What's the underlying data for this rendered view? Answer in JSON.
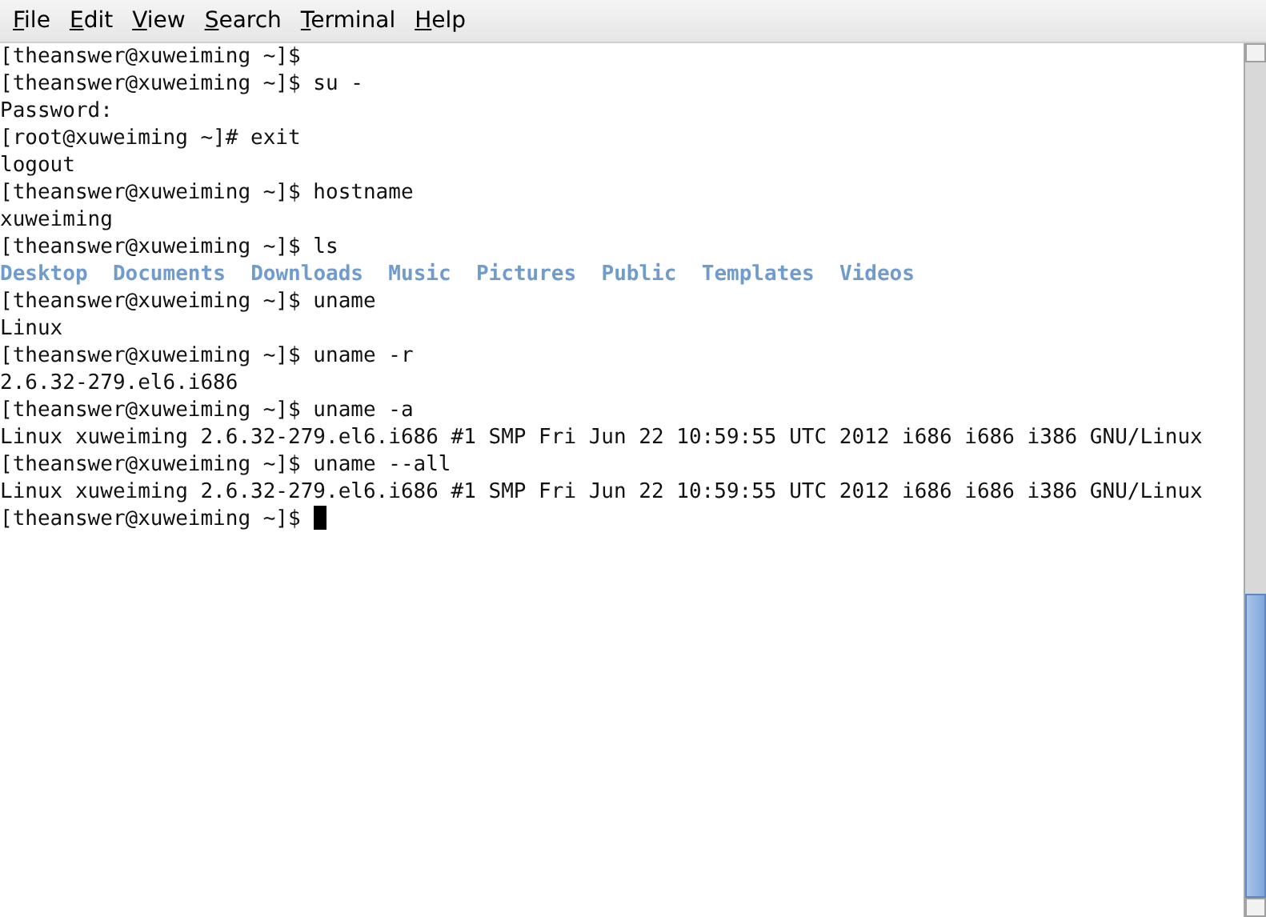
{
  "menu": [
    {
      "label": "File"
    },
    {
      "label": "Edit"
    },
    {
      "label": "View"
    },
    {
      "label": "Search"
    },
    {
      "label": "Terminal"
    },
    {
      "label": "Help"
    }
  ],
  "terminal": {
    "lines": [
      {
        "kind": "text",
        "text": "[theanswer@xuweiming ~]$"
      },
      {
        "kind": "text",
        "text": "[theanswer@xuweiming ~]$ su -"
      },
      {
        "kind": "text",
        "text": "Password:"
      },
      {
        "kind": "text",
        "text": "[root@xuweiming ~]# exit"
      },
      {
        "kind": "text",
        "text": "logout"
      },
      {
        "kind": "text",
        "text": "[theanswer@xuweiming ~]$ hostname"
      },
      {
        "kind": "text",
        "text": "xuweiming"
      },
      {
        "kind": "text",
        "text": "[theanswer@xuweiming ~]$ ls"
      },
      {
        "kind": "dirs",
        "entries": [
          "Desktop",
          "Documents",
          "Downloads",
          "Music",
          "Pictures",
          "Public",
          "Templates",
          "Videos"
        ]
      },
      {
        "kind": "text",
        "text": "[theanswer@xuweiming ~]$ uname"
      },
      {
        "kind": "text",
        "text": "Linux"
      },
      {
        "kind": "text",
        "text": "[theanswer@xuweiming ~]$ uname -r"
      },
      {
        "kind": "text",
        "text": "2.6.32-279.el6.i686"
      },
      {
        "kind": "text",
        "text": "[theanswer@xuweiming ~]$ uname -a"
      },
      {
        "kind": "text",
        "text": "Linux xuweiming 2.6.32-279.el6.i686 #1 SMP Fri Jun 22 10:59:55 UTC 2012 i686 i686 i386 GNU/Linux"
      },
      {
        "kind": "text",
        "text": "[theanswer@xuweiming ~]$ uname --all"
      },
      {
        "kind": "text",
        "text": "Linux xuweiming 2.6.32-279.el6.i686 #1 SMP Fri Jun 22 10:59:55 UTC 2012 i686 i686 i386 GNU/Linux"
      },
      {
        "kind": "text",
        "text": "[theanswer@xuweiming ~]$",
        "cursor": true
      }
    ]
  }
}
